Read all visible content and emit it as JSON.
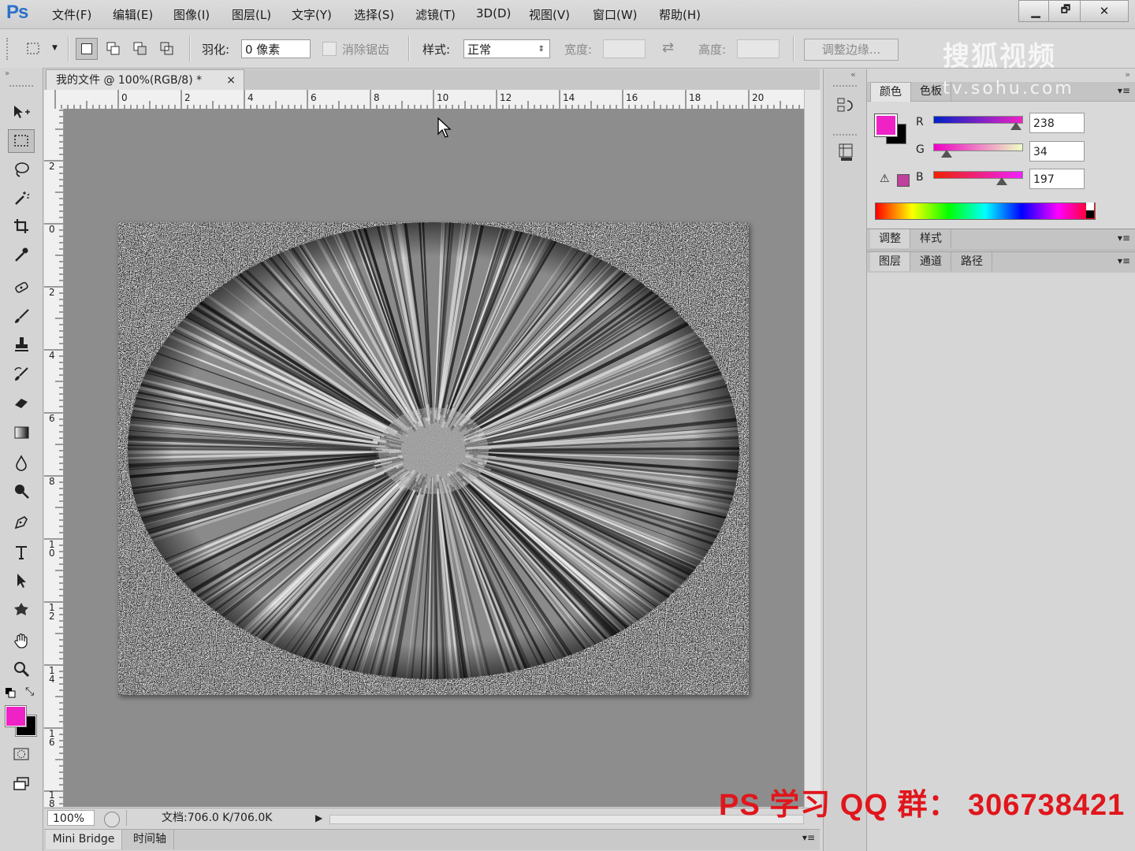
{
  "app": {
    "logo": "Ps"
  },
  "menu": [
    "文件(F)",
    "编辑(E)",
    "图像(I)",
    "图层(L)",
    "文字(Y)",
    "选择(S)",
    "滤镜(T)",
    "3D(D)",
    "视图(V)",
    "窗口(W)",
    "帮助(H)"
  ],
  "window_controls": {
    "minimize": "▁",
    "restore": "🗗",
    "close": "✕"
  },
  "options": {
    "feather_label": "羽化:",
    "feather_value": "0 像素",
    "antialias_label": "消除锯齿",
    "style_label": "样式:",
    "style_value": "正常",
    "width_label": "宽度:",
    "height_label": "高度:",
    "refine_button": "调整边缘..."
  },
  "watermark": {
    "line1": "搜狐视频",
    "line2": "tv.sohu.com"
  },
  "document": {
    "tab_title": "我的文件 @ 100%(RGB/8) *",
    "close": "×",
    "ruler_top": [
      "0",
      "2",
      "4",
      "6",
      "8",
      "10",
      "12",
      "14",
      "16",
      "18",
      "20"
    ],
    "ruler_left": [
      "2",
      "0",
      "2",
      "4",
      "6",
      "8",
      "1 0",
      "1 2",
      "1 4",
      "1 6",
      "1 8"
    ],
    "zoom": "100%",
    "doc_info": "文档:706.0 K/706.0K"
  },
  "bottom_tabs": [
    "Mini Bridge",
    "时间轴"
  ],
  "color_panel": {
    "tabs": [
      "颜色",
      "色板"
    ],
    "foreground": "#ee22c5",
    "background": "#000000",
    "r_label": "R",
    "g_label": "G",
    "b_label": "B",
    "r": "238",
    "g": "34",
    "b": "197"
  },
  "adjust_tabs": [
    "调整",
    "样式"
  ],
  "layer_tabs": [
    "图层",
    "通道",
    "路径"
  ],
  "overlay_text": "PS 学习 QQ 群： 306738421"
}
